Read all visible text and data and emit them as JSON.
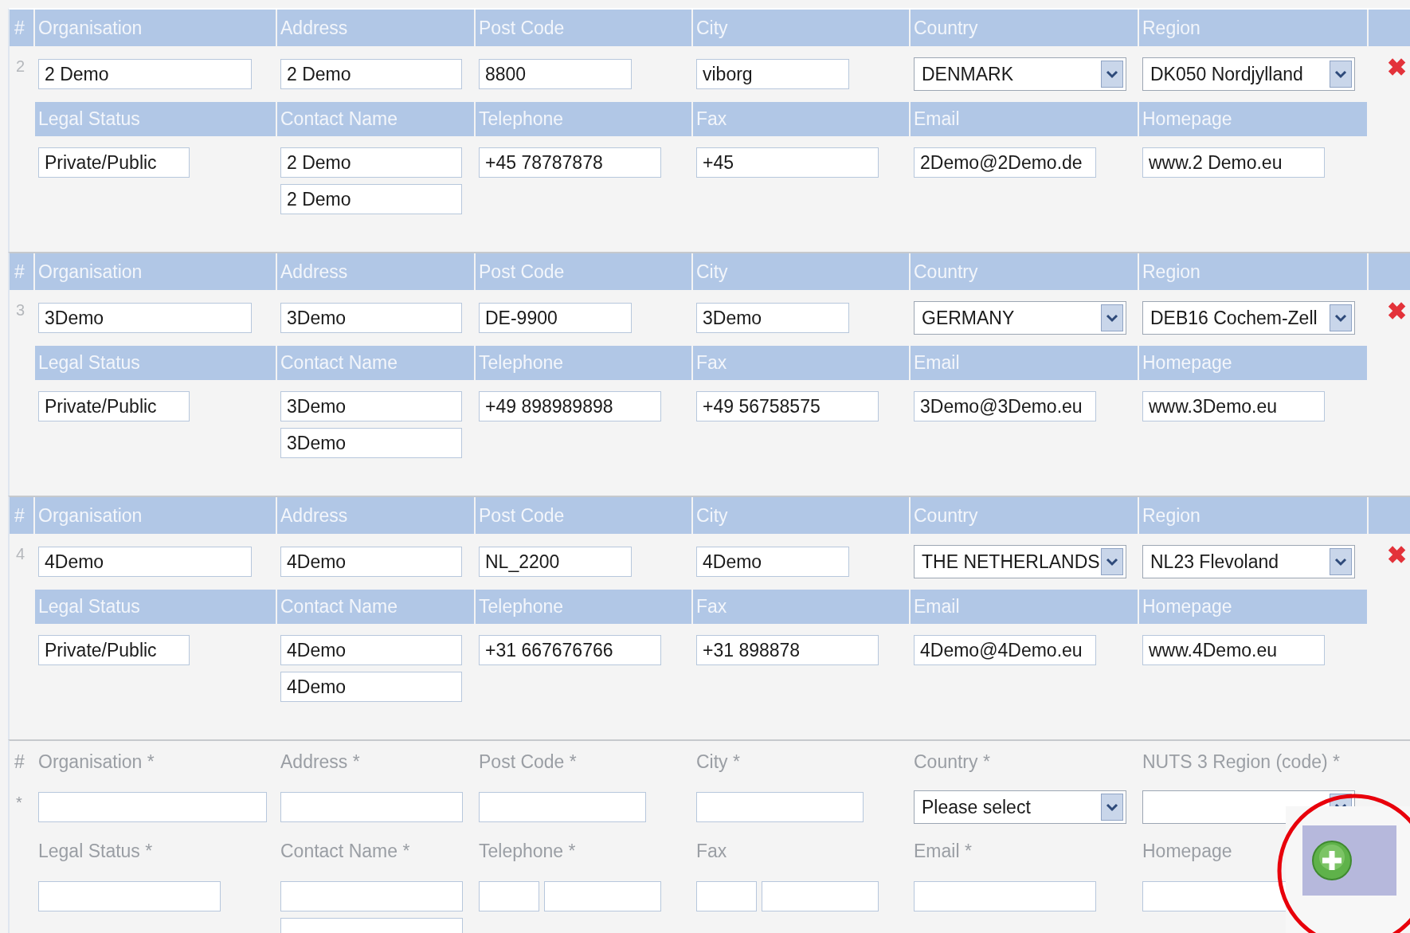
{
  "records": [
    {
      "number": "2",
      "delete_label": "✖",
      "top": [
        {
          "label": "Organisation",
          "kind": "text",
          "value": "2 Demo"
        },
        {
          "label": "Address",
          "kind": "text",
          "value": "2 Demo"
        },
        {
          "label": "Post Code",
          "kind": "text",
          "value": "8800"
        },
        {
          "label": "City",
          "kind": "text",
          "value": "viborg"
        },
        {
          "label": "Country",
          "kind": "select",
          "value": "DENMARK"
        },
        {
          "label": "Region",
          "kind": "select",
          "value": "DK050 Nordjylland"
        }
      ],
      "bottom": [
        {
          "label": "Legal Status",
          "kind": "text",
          "value": "Private/Public"
        },
        {
          "label": "Contact Name",
          "kind": "double",
          "values": [
            "2 Demo",
            "2 Demo"
          ]
        },
        {
          "label": "Telephone",
          "kind": "text",
          "value": "+45 78787878"
        },
        {
          "label": "Fax",
          "kind": "text",
          "value": "+45"
        },
        {
          "label": "Email",
          "kind": "text",
          "value": "2Demo@2Demo.de"
        },
        {
          "label": "Homepage",
          "kind": "text",
          "value": "www.2 Demo.eu"
        }
      ]
    },
    {
      "number": "3",
      "delete_label": "✖",
      "top": [
        {
          "label": "Organisation",
          "kind": "text",
          "value": "3Demo"
        },
        {
          "label": "Address",
          "kind": "text",
          "value": "3Demo"
        },
        {
          "label": "Post Code",
          "kind": "text",
          "value": "DE-9900"
        },
        {
          "label": "City",
          "kind": "text",
          "value": "3Demo"
        },
        {
          "label": "Country",
          "kind": "select",
          "value": "GERMANY"
        },
        {
          "label": "Region",
          "kind": "select",
          "value": "DEB16 Cochem-Zell"
        }
      ],
      "bottom": [
        {
          "label": "Legal Status",
          "kind": "text",
          "value": "Private/Public"
        },
        {
          "label": "Contact Name",
          "kind": "double",
          "values": [
            "3Demo",
            "3Demo"
          ]
        },
        {
          "label": "Telephone",
          "kind": "text",
          "value": "+49 898989898"
        },
        {
          "label": "Fax",
          "kind": "text",
          "value": "+49 56758575"
        },
        {
          "label": "Email",
          "kind": "text",
          "value": "3Demo@3Demo.eu"
        },
        {
          "label": "Homepage",
          "kind": "text",
          "value": "www.3Demo.eu"
        }
      ]
    },
    {
      "number": "4",
      "delete_label": "✖",
      "top": [
        {
          "label": "Organisation",
          "kind": "text",
          "value": "4Demo"
        },
        {
          "label": "Address",
          "kind": "text",
          "value": "4Demo"
        },
        {
          "label": "Post Code",
          "kind": "text",
          "value": "NL_2200"
        },
        {
          "label": "City",
          "kind": "text",
          "value": "4Demo"
        },
        {
          "label": "Country",
          "kind": "select",
          "value": "THE NETHERLANDS"
        },
        {
          "label": "Region",
          "kind": "select",
          "value": "NL23 Flevoland"
        }
      ],
      "bottom": [
        {
          "label": "Legal Status",
          "kind": "text",
          "value": "Private/Public"
        },
        {
          "label": "Contact Name",
          "kind": "double",
          "values": [
            "4Demo",
            "4Demo"
          ]
        },
        {
          "label": "Telephone",
          "kind": "text",
          "value": "+31 667676766"
        },
        {
          "label": "Fax",
          "kind": "text",
          "value": "+31 898878"
        },
        {
          "label": "Email",
          "kind": "text",
          "value": "4Demo@4Demo.eu"
        },
        {
          "label": "Homepage",
          "kind": "text",
          "value": "www.4Demo.eu"
        }
      ]
    }
  ],
  "number_header": "#",
  "new_entry": {
    "number_header": "#",
    "marker": "*",
    "top": [
      {
        "label": "Organisation *",
        "kind": "text"
      },
      {
        "label": "Address *",
        "kind": "text"
      },
      {
        "label": "Post Code *",
        "kind": "text"
      },
      {
        "label": "City *",
        "kind": "text"
      },
      {
        "label": "Country *",
        "kind": "select",
        "value": "Please select"
      },
      {
        "label": "NUTS 3 Region (code) *",
        "kind": "select"
      }
    ],
    "bottom": [
      {
        "label": "Legal Status *",
        "kind": "text"
      },
      {
        "label": "Contact Name *",
        "kind": "double"
      },
      {
        "label": "Telephone *",
        "kind": "split"
      },
      {
        "label": "Fax",
        "kind": "split"
      },
      {
        "label": "Email *",
        "kind": "text"
      },
      {
        "label": "Homepage",
        "kind": "text"
      }
    ]
  }
}
